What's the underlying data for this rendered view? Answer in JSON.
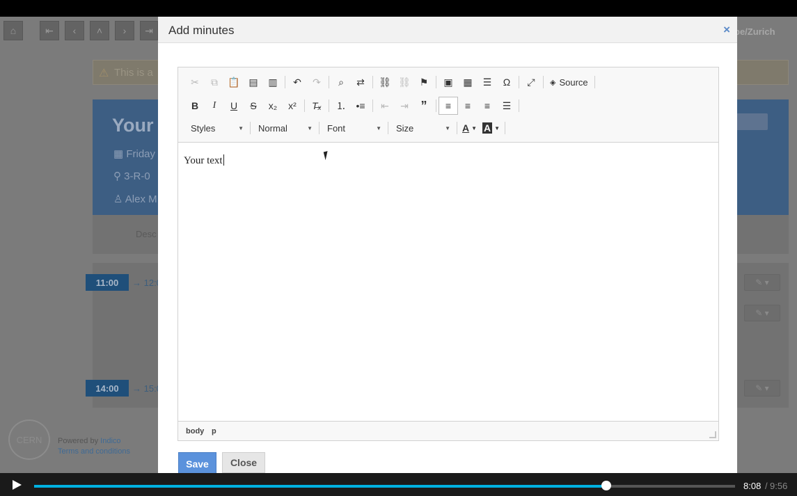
{
  "background": {
    "timezone": "pe/Zurich",
    "warning_text": "This is a",
    "event": {
      "title": "Your",
      "date": "Friday",
      "room": "3-R-0",
      "person": "Alex M"
    },
    "description_label": "Desc",
    "timetable": [
      {
        "start": "11:00",
        "arrow": "→ 12:0"
      },
      {
        "start": "14:00",
        "arrow": "→ 15:0"
      }
    ],
    "footer": {
      "powered_by": "Powered by",
      "indico": "Indico",
      "terms": "Terms and conditions",
      "cern": "CERN"
    }
  },
  "modal": {
    "title": "Add minutes",
    "close_symbol": "×",
    "toolbar": {
      "source_label": "Source",
      "styles_label": "Styles",
      "format_label": "Normal",
      "font_label": "Font",
      "size_label": "Size"
    },
    "content_text": "Your text",
    "path": [
      "body",
      "p"
    ],
    "save_label": "Save",
    "close_label": "Close"
  },
  "video": {
    "current_time": "8:08",
    "separator": "/",
    "total_time": "9:56",
    "progress": 0.816
  }
}
